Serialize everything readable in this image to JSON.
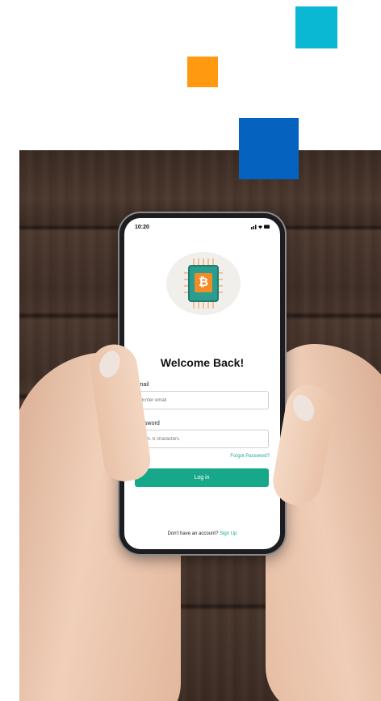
{
  "colors": {
    "accent_cyan": "#0bb8d3",
    "accent_orange": "#ff9a10",
    "accent_blue": "#0563bf",
    "brand_teal": "#17a88a",
    "wood_dark": "#3a2a22"
  },
  "phone": {
    "status": {
      "time": "10:20",
      "icons": "signal-wifi-battery"
    },
    "logo": {
      "icon": "bitcoin-chip-icon",
      "glyph": "₿"
    },
    "title": "Welcome Back!",
    "email": {
      "label": "Email",
      "placeholder": "Enter email"
    },
    "password": {
      "label": "Password",
      "placeholder": "Min. 6 characters"
    },
    "forgot_label": "Forgot Password?",
    "login_label": "Log in",
    "signup": {
      "prompt": "Don't have an account?",
      "link": "Sign Up"
    }
  }
}
